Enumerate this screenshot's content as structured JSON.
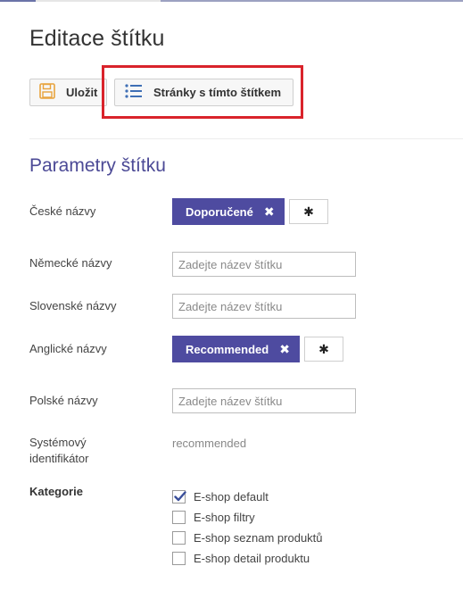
{
  "page": {
    "title": "Editace štítku"
  },
  "toolbar": {
    "save_label": "Uložit",
    "pages_label": "Stránky s tímto štítkem"
  },
  "section": {
    "title": "Parametry štítku"
  },
  "fields": {
    "czech": {
      "label": "České názvy",
      "tag": "Doporučené",
      "remove_symbol": "✖",
      "star_symbol": "✱"
    },
    "german": {
      "label": "Německé názvy",
      "placeholder": "Zadejte název štítku"
    },
    "slovak": {
      "label": "Slovenské názvy",
      "placeholder": "Zadejte název štítku"
    },
    "english": {
      "label": "Anglické názvy",
      "tag": "Recommended",
      "remove_symbol": "✖",
      "star_symbol": "✱"
    },
    "polish": {
      "label": "Polské názvy",
      "placeholder": "Zadejte název štítku"
    },
    "system_id": {
      "label_line1": "Systémový",
      "label_line2": "identifikátor",
      "value": "recommended"
    }
  },
  "categories": {
    "label": "Kategorie",
    "items": [
      {
        "label": "E-shop default",
        "checked": true
      },
      {
        "label": "E-shop filtry",
        "checked": false
      },
      {
        "label": "E-shop seznam produktů",
        "checked": false
      },
      {
        "label": "E-shop detail produktu",
        "checked": false
      }
    ]
  },
  "colors": {
    "accent": "#4e4ba0",
    "section_title": "#4c4a96",
    "highlight": "#d9232b",
    "check": "#3a4f9a",
    "save_icon": "#e8a33d",
    "list_icon": "#3f6fb5"
  },
  "icons": {
    "save": "floppy-disk-icon",
    "pages": "list-icon"
  }
}
